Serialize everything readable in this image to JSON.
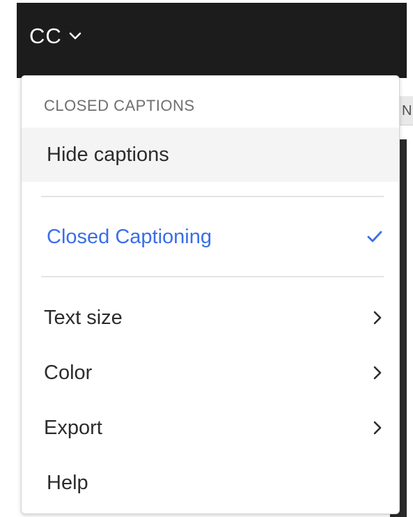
{
  "toolbar": {
    "cc_label": "CC",
    "chevron_icon": "chevron-down-icon"
  },
  "side_tab": {
    "partial_text": "N"
  },
  "menu": {
    "header": "CLOSED CAPTIONS",
    "hide_captions_label": "Hide captions",
    "closed_captioning_label": "Closed Captioning",
    "closed_captioning_selected": true,
    "check_icon": "checkmark-icon",
    "text_size_label": "Text size",
    "color_label": "Color",
    "export_label": "Export",
    "help_label": "Help",
    "submenu_icon": "chevron-right-icon"
  },
  "colors": {
    "toolbar_bg": "#1c1c1c",
    "accent": "#3a6ee8",
    "text": "#2c2c2c",
    "header_text": "#6e6e6e",
    "hover_bg": "#f4f4f4"
  }
}
